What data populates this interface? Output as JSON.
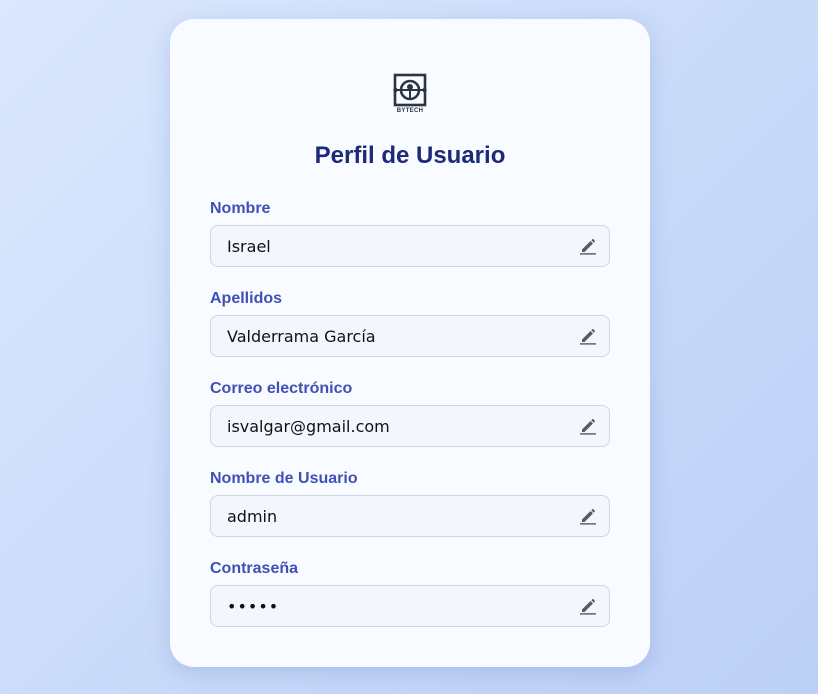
{
  "brand": {
    "logo_text": "BYTECH"
  },
  "page": {
    "title": "Perfil de Usuario"
  },
  "fields": [
    {
      "label": "Nombre",
      "value": "Israel",
      "type": "text",
      "icon": "pencil-icon"
    },
    {
      "label": "Apellidos",
      "value": "Valderrama García",
      "type": "text",
      "icon": "pencil-icon"
    },
    {
      "label": "Correo electrónico",
      "value": "isvalgar@gmail.com",
      "type": "text",
      "icon": "pencil-icon"
    },
    {
      "label": "Nombre de Usuario",
      "value": "admin",
      "type": "text",
      "icon": "pencil-icon"
    },
    {
      "label": "Contraseña",
      "value": "admin",
      "type": "password",
      "icon": "pencil-icon"
    }
  ],
  "colors": {
    "title": "#1e2a78",
    "label": "#3f51b5",
    "icon": "#555c66",
    "card": "#f8fbff",
    "input_bg": "#f3f7fd",
    "input_border": "#cfd6e2"
  }
}
